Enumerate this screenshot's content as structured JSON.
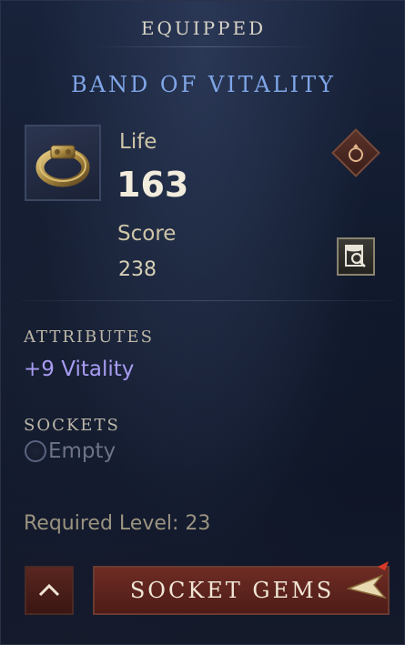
{
  "header": {
    "title": "EQUIPPED"
  },
  "item": {
    "name": "BAND OF VITALITY",
    "icon": "ring-icon",
    "life_label": "Life",
    "life_value": "163",
    "score_label": "Score",
    "score_value": "238",
    "slot_icon": "ring-slot-icon",
    "compare_icon": "compare-search-icon"
  },
  "attributes": {
    "heading": "ATTRIBUTES",
    "items": [
      "+9 Vitality"
    ]
  },
  "sockets": {
    "heading": "SOCKETS",
    "status": "Empty"
  },
  "requirements": {
    "text": "Required Level: 23"
  },
  "actions": {
    "collapse_icon": "chevron-up-icon",
    "socket_gems_label": "SOCKET GEMS"
  },
  "colors": {
    "item_name": "#7fa6e8",
    "attribute": "#a89cf2",
    "button_red": "#6e2c24"
  }
}
